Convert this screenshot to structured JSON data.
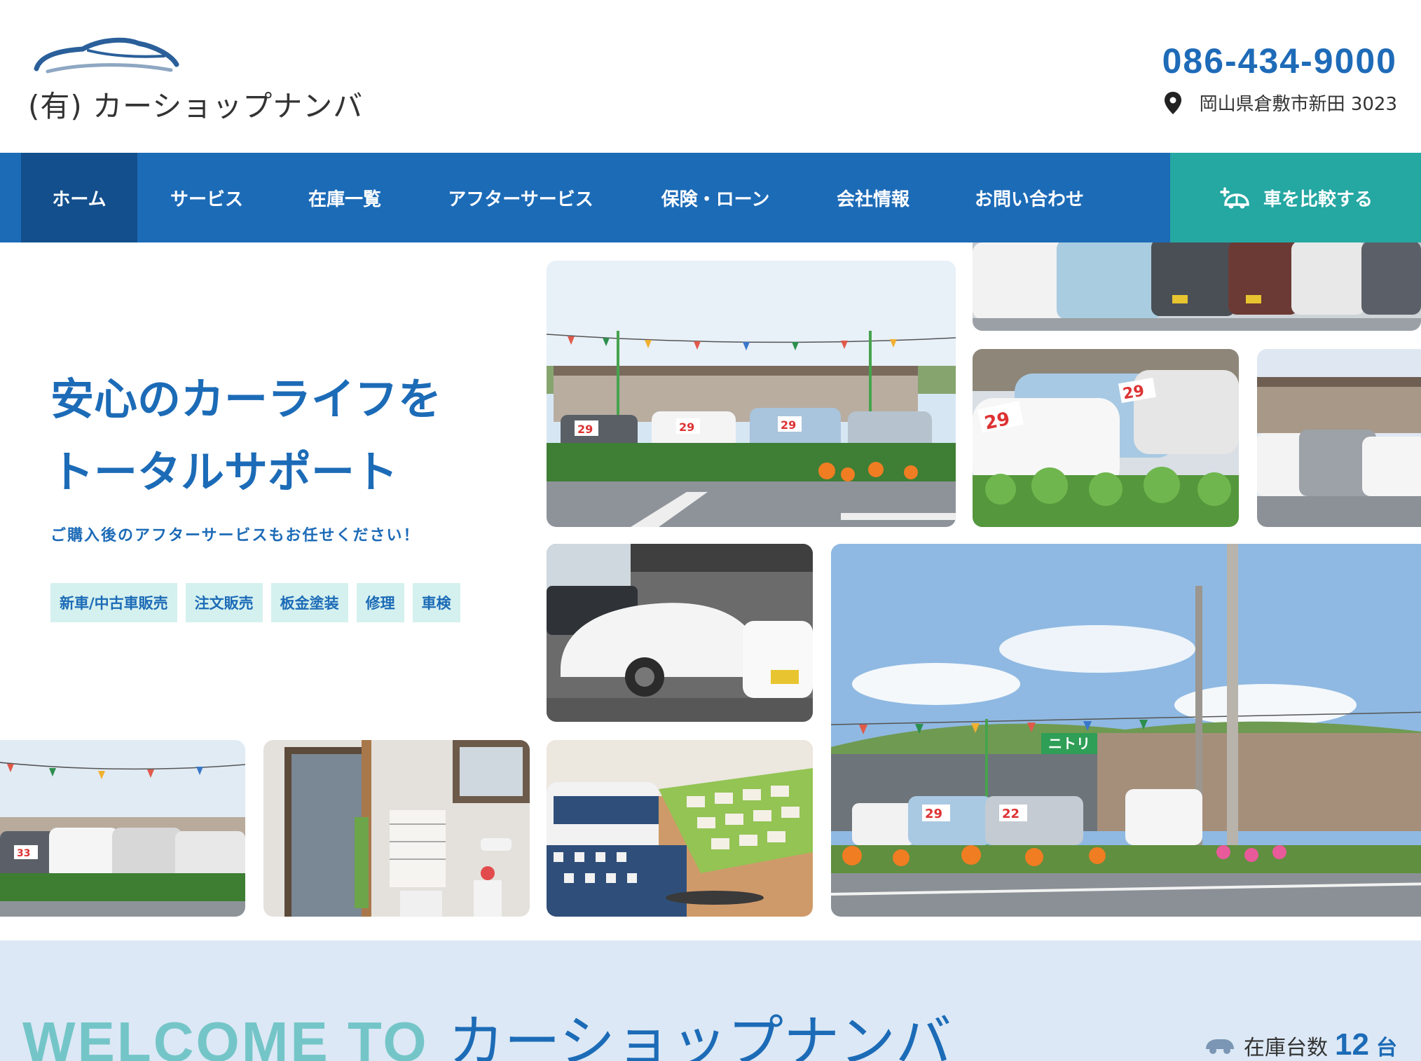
{
  "header": {
    "logo_text": "(有) カーショップナンバ",
    "phone": "086-434-9000",
    "address": "岡山県倉敷市新田 3023"
  },
  "nav": {
    "items": [
      {
        "label": "ホーム",
        "active": true
      },
      {
        "label": "サービス"
      },
      {
        "label": "在庫一覧"
      },
      {
        "label": "アフターサービス"
      },
      {
        "label": "保険・ローン"
      },
      {
        "label": "会社情報"
      },
      {
        "label": "お問い合わせ"
      }
    ],
    "compare_label": "車を比較する"
  },
  "hero": {
    "title_line1": "安心のカーライフを",
    "title_line2": "トータルサポート",
    "subtitle": "ご購入後のアフターサービスもお任せください！",
    "tags": [
      "新車/中古車販売",
      "注文販売",
      "板金塗装",
      "修理",
      "車検"
    ]
  },
  "welcome": {
    "title_en": "WELCOME TO",
    "title_jp": "カーショップナンバ",
    "stock_label": "在庫台数",
    "stock_count": "12",
    "stock_unit": "台"
  },
  "colors": {
    "brand_blue": "#1c6bb7",
    "nav_active": "#134f8c",
    "compare_teal": "#25a7a2",
    "tag_bg": "#d5f1ef",
    "welcome_bg": "#dce8f5",
    "welcome_en": "#74c5c8"
  }
}
